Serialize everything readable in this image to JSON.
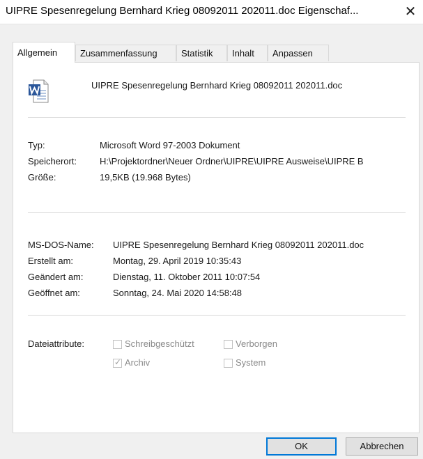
{
  "window": {
    "title": "UIPRE Spesenregelung Bernhard Krieg 08092011 202011.doc Eigenschaf...",
    "close_glyph": "✕"
  },
  "tabs": [
    {
      "label": "Allgemein",
      "active": true
    },
    {
      "label": "Zusammenfassung",
      "active": false
    },
    {
      "label": "Statistik",
      "active": false
    },
    {
      "label": "Inhalt",
      "active": false
    },
    {
      "label": "Anpassen",
      "active": false
    }
  ],
  "file": {
    "icon": "word-document-icon",
    "name": "UIPRE Spesenregelung Bernhard Krieg 08092011 202011.doc"
  },
  "details": {
    "type_label": "Typ:",
    "type_value": "Microsoft Word 97-2003 Dokument",
    "location_label": "Speicherort:",
    "location_value": "H:\\Projektordner\\Neuer Ordner\\UIPRE\\UIPRE Ausweise\\UIPRE B",
    "size_label": "Größe:",
    "size_value": "19,5KB (19.968 Bytes)"
  },
  "dates": {
    "dosname_label": "MS-DOS-Name:",
    "dosname_value": "UIPRE Spesenregelung Bernhard Krieg 08092011 202011.doc",
    "created_label": "Erstellt am:",
    "created_value": "Montag, 29. April 2019 10:35:43",
    "modified_label": "Geändert am:",
    "modified_value": "Dienstag, 11. Oktober 2011 10:07:54",
    "opened_label": "Geöffnet am:",
    "opened_value": "Sonntag, 24. Mai 2020 14:58:48"
  },
  "attributes": {
    "label": "Dateiattribute:",
    "readonly": {
      "label": "Schreibgeschützt",
      "checked": false
    },
    "hidden": {
      "label": "Verborgen",
      "checked": false
    },
    "archive": {
      "label": "Archiv",
      "checked": true
    },
    "system": {
      "label": "System",
      "checked": false
    }
  },
  "buttons": {
    "ok": "OK",
    "cancel": "Abbrechen"
  },
  "colors": {
    "accent": "#0078d7",
    "word_blue": "#2b579a"
  }
}
